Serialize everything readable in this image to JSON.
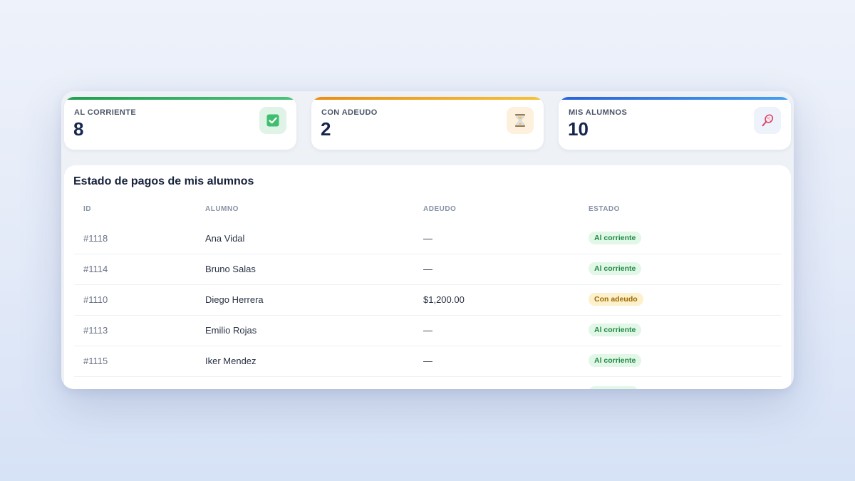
{
  "kpis": [
    {
      "label": "AL CORRIENTE",
      "value": "8",
      "icon": "checkbox-check-icon",
      "accent": "#2fae5d"
    },
    {
      "label": "CON ADEUDO",
      "value": "2",
      "icon": "hourglass-icon",
      "accent": "#f0a51d"
    },
    {
      "label": "MIS ALUMNOS",
      "value": "10",
      "icon": "tennis-racket-icon",
      "accent": "#2f74e0"
    }
  ],
  "table": {
    "title": "Estado de pagos de mis alumnos",
    "headers": {
      "id": "ID",
      "alumno": "ALUMNO",
      "adeudo": "ADEUDO",
      "estado": "ESTADO"
    },
    "rows": [
      {
        "id": "#1118",
        "alumno": "Ana Vidal",
        "adeudo": "—",
        "estado": "Al corriente",
        "status": "ok"
      },
      {
        "id": "#1114",
        "alumno": "Bruno Salas",
        "adeudo": "—",
        "estado": "Al corriente",
        "status": "ok"
      },
      {
        "id": "#1110",
        "alumno": "Diego Herrera",
        "adeudo": "$1,200.00",
        "estado": "Con adeudo",
        "status": "due"
      },
      {
        "id": "#1113",
        "alumno": "Emilio Rojas",
        "adeudo": "—",
        "estado": "Al corriente",
        "status": "ok"
      },
      {
        "id": "#1115",
        "alumno": "Iker Mendez",
        "adeudo": "—",
        "estado": "Al corriente",
        "status": "ok"
      },
      {
        "id": "",
        "alumno": "",
        "adeudo": "",
        "estado": "",
        "status": "ok"
      }
    ]
  }
}
